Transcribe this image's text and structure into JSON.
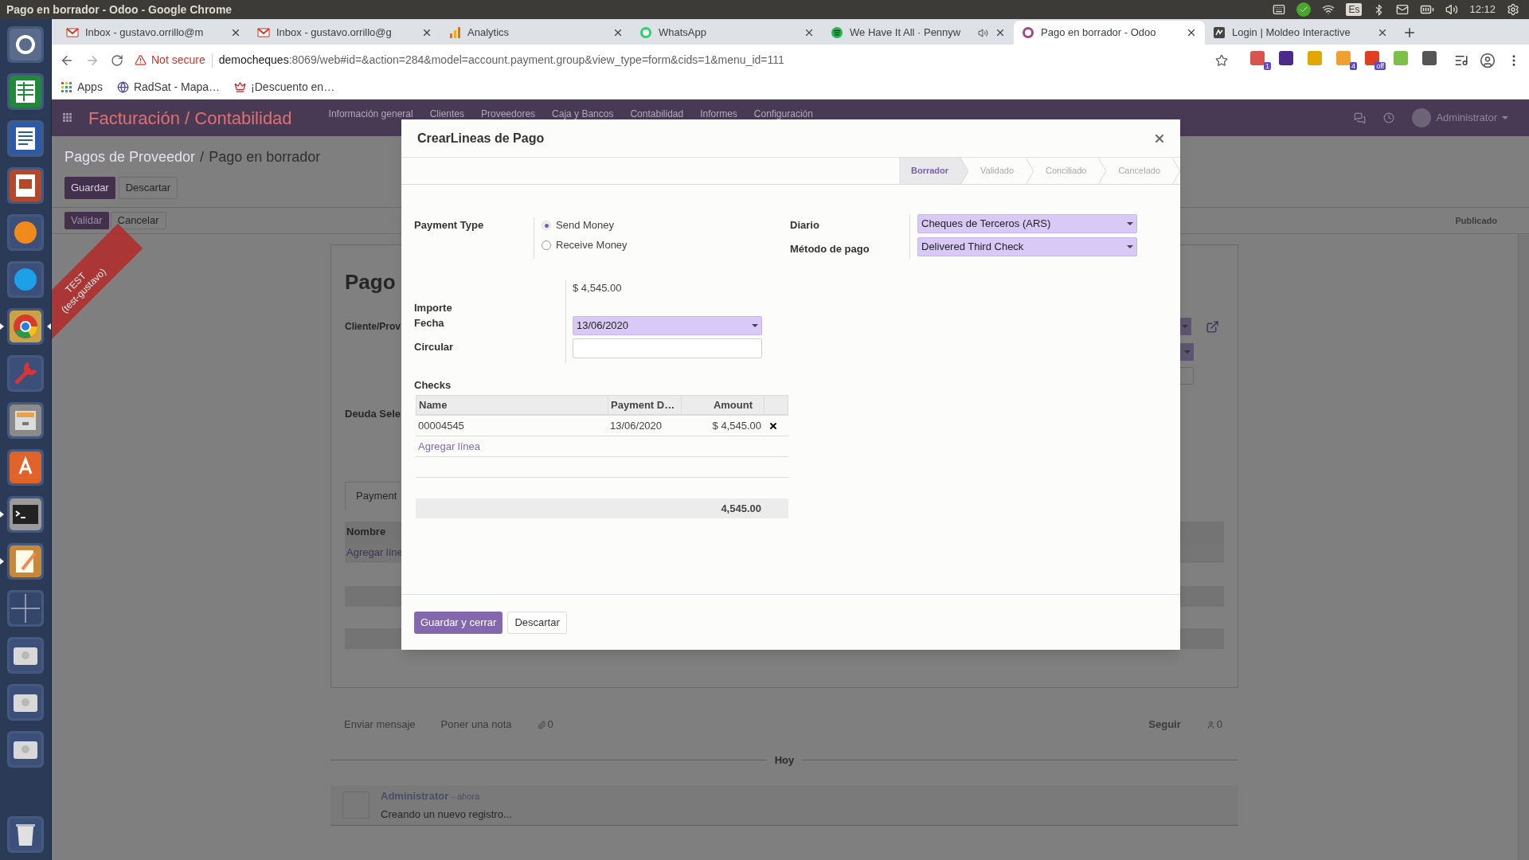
{
  "system_bar": {
    "title": "Pago en borrador - Odoo - Google Chrome",
    "keyboard": "Es",
    "time": "12:12"
  },
  "dock": [
    {
      "kind": "ubuntu",
      "running": false,
      "focused": false
    },
    {
      "kind": "spreadsheet",
      "running": false,
      "focused": false
    },
    {
      "kind": "document",
      "running": false,
      "focused": false
    },
    {
      "kind": "presentation",
      "running": false,
      "focused": false
    },
    {
      "kind": "firefox",
      "running": false,
      "focused": false
    },
    {
      "kind": "skype",
      "running": false,
      "focused": false
    },
    {
      "kind": "chrome",
      "running": true,
      "focused": true
    },
    {
      "kind": "settings",
      "running": false,
      "focused": false
    },
    {
      "kind": "files",
      "running": false,
      "focused": false
    },
    {
      "kind": "store",
      "running": false,
      "focused": false
    },
    {
      "kind": "terminal",
      "running": true,
      "focused": false
    },
    {
      "kind": "editor",
      "running": true,
      "focused": false
    },
    {
      "kind": "workspaces",
      "running": false,
      "focused": false
    },
    {
      "kind": "drive",
      "running": false,
      "focused": false
    },
    {
      "kind": "drive",
      "running": false,
      "focused": false
    },
    {
      "kind": "drive",
      "running": false,
      "focused": false
    },
    {
      "kind": "trash",
      "running": false,
      "focused": false
    }
  ],
  "tabs": [
    {
      "kind": "gmail",
      "title": "Inbox - gustavo.orrillo@m",
      "selected": false,
      "audio": false
    },
    {
      "kind": "gmail",
      "title": "Inbox - gustavo.orrillo@g",
      "selected": false,
      "audio": false
    },
    {
      "kind": "analytics",
      "title": "Analytics",
      "selected": false,
      "audio": false
    },
    {
      "kind": "whatsapp",
      "title": "WhatsApp",
      "selected": false,
      "audio": false
    },
    {
      "kind": "spotify",
      "title": "We Have It All · Pennyw",
      "selected": false,
      "audio": true
    },
    {
      "kind": "odoo",
      "title": "Pago en borrador - Odoo",
      "selected": true,
      "audio": false
    },
    {
      "kind": "moldeo",
      "title": "Login | Moldeo Interactive",
      "selected": false,
      "audio": false
    }
  ],
  "address_bar": {
    "security": "Not secure",
    "host": "democheques",
    "rest": ":8069/web#id=&action=284&model=account.payment.group&view_type=form&cids=1&menu_id=111"
  },
  "extensions": [
    {
      "color": "#d9534f",
      "badge": "1"
    },
    {
      "color": "#4a2a8a"
    },
    {
      "color": "#e0a800"
    },
    {
      "color": "#f0a030",
      "badge": "4"
    },
    {
      "color": "#e04020",
      "badge": "off"
    },
    {
      "color": "#7cc04a"
    },
    {
      "color": "#555555"
    }
  ],
  "bookmarks": [
    {
      "kind": "apps",
      "label": "Apps"
    },
    {
      "kind": "globe",
      "label": "RadSat - Mapa…"
    },
    {
      "kind": "crown",
      "label": "¡Descuento en…"
    }
  ],
  "odoo": {
    "app_title": "Facturación / Contabilidad",
    "menu": [
      "Información general",
      "Clientes",
      "Proveedores",
      "Caja y Bancos",
      "Contabilidad",
      "Informes",
      "Configuración"
    ],
    "user": "Administrator",
    "ribbon": [
      "TEST",
      "(test-gustavo)"
    ],
    "breadcrumb": [
      "Pagos de Proveedor",
      "Pago en borrador"
    ],
    "breadcrumb_separator": "/",
    "buttons": [
      "Guardar",
      "Descartar"
    ],
    "status_buttons": [
      "Validar",
      "Cancelar"
    ],
    "status": "Publicado",
    "sheet": {
      "title": "Pago",
      "labels": [
        "Cliente/Prov",
        "Deuda Sele"
      ],
      "tab": "Payment",
      "table_header": "Nombre",
      "add_line": "Agregar líne"
    },
    "chatter": {
      "send": "Enviar mensaje",
      "note": "Poner una nota",
      "attachments": "0",
      "follow": "Seguir",
      "followers": "0",
      "date": "Hoy",
      "message": {
        "author": "Administrator",
        "time": "- ahora",
        "body": "Creando un nuevo registro..."
      }
    }
  },
  "modal": {
    "title": "CrearLineas de Pago",
    "stages": [
      {
        "label": "Borrador",
        "selected": true
      },
      {
        "label": "Validado",
        "selected": false
      },
      {
        "label": "Conciliado",
        "selected": false
      },
      {
        "label": "Cancelado",
        "selected": false
      }
    ],
    "payment_type": {
      "label": "Payment Type",
      "options": [
        {
          "label": "Send Money",
          "selected": true
        },
        {
          "label": "Receive Money",
          "selected": false
        }
      ]
    },
    "journal": {
      "label": "Diario",
      "value": "Cheques de Terceros (ARS)"
    },
    "method": {
      "label": "Método de pago",
      "value": "Delivered Third Check"
    },
    "amount": {
      "label": "Importe",
      "value": "$ 4,545.00"
    },
    "date": {
      "label": "Fecha",
      "value": "13/06/2020"
    },
    "memo": {
      "label": "Circular"
    },
    "checks": {
      "label": "Checks",
      "columns": [
        "Name",
        "Payment D…",
        "Amount"
      ],
      "rows": [
        {
          "cells": [
            "00004545",
            "13/06/2020",
            "$ 4,545.00"
          ]
        }
      ],
      "add_line": "Agregar línea",
      "total": "4,545.00"
    },
    "footer": [
      "Guardar y cerrar",
      "Descartar"
    ]
  }
}
